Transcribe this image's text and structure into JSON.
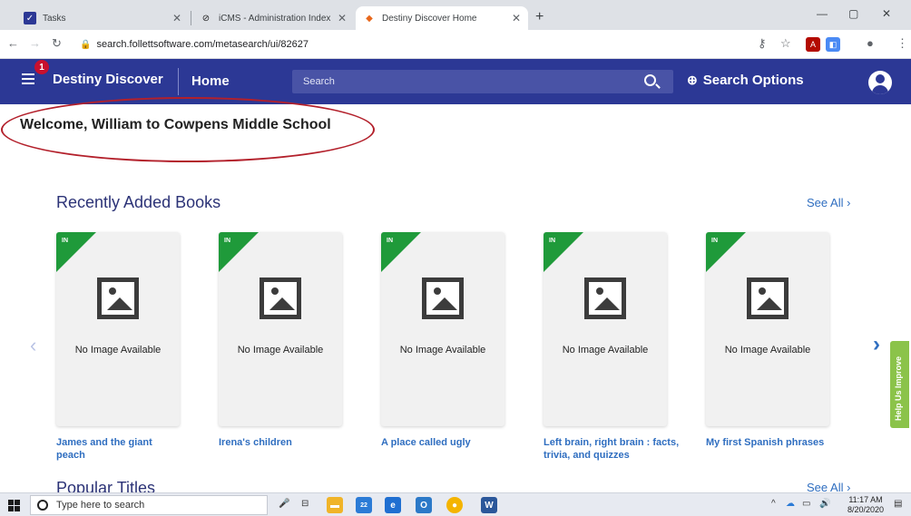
{
  "browser": {
    "tabs": [
      {
        "title": "Tasks",
        "active": false
      },
      {
        "title": "iCMS - Administration Index",
        "active": false
      },
      {
        "title": "Destiny Discover Home",
        "active": true
      }
    ],
    "url": "search.follettsoftware.com/metasearch/ui/82627",
    "colors": {
      "tabstrip": "#dee1e6"
    }
  },
  "header": {
    "notification_count": "1",
    "brand": "Destiny Discover",
    "home_label": "Home",
    "search_placeholder": "Search",
    "search_options_label": "Search Options",
    "colors": {
      "bar": "#2c3895",
      "badge": "#c8102e"
    }
  },
  "main": {
    "welcome": "Welcome, William to Cowpens Middle School",
    "recently_added": {
      "title": "Recently Added Books",
      "see_all": "See All",
      "books": [
        {
          "status": "IN",
          "image_text": "No Image Available",
          "title": "James and the giant peach"
        },
        {
          "status": "IN",
          "image_text": "No Image Available",
          "title": "Irena's children"
        },
        {
          "status": "IN",
          "image_text": "No Image Available",
          "title": "A place called ugly"
        },
        {
          "status": "IN",
          "image_text": "No Image Available",
          "title": "Left brain, right brain : facts, trivia, and quizzes"
        },
        {
          "status": "IN",
          "image_text": "No Image Available",
          "title": "My first Spanish phrases"
        }
      ]
    },
    "popular": {
      "title": "Popular Titles",
      "see_all": "See All"
    },
    "help_tab": "Help Us Improve",
    "colors": {
      "link": "#2f6ec0",
      "in_badge": "#1f9a3a",
      "help": "#8bc34a",
      "annotation": "#b3202b"
    }
  },
  "taskbar": {
    "search_placeholder": "Type here to search",
    "time": "11:17 AM",
    "date": "8/20/2020",
    "edge_badge": "22"
  }
}
